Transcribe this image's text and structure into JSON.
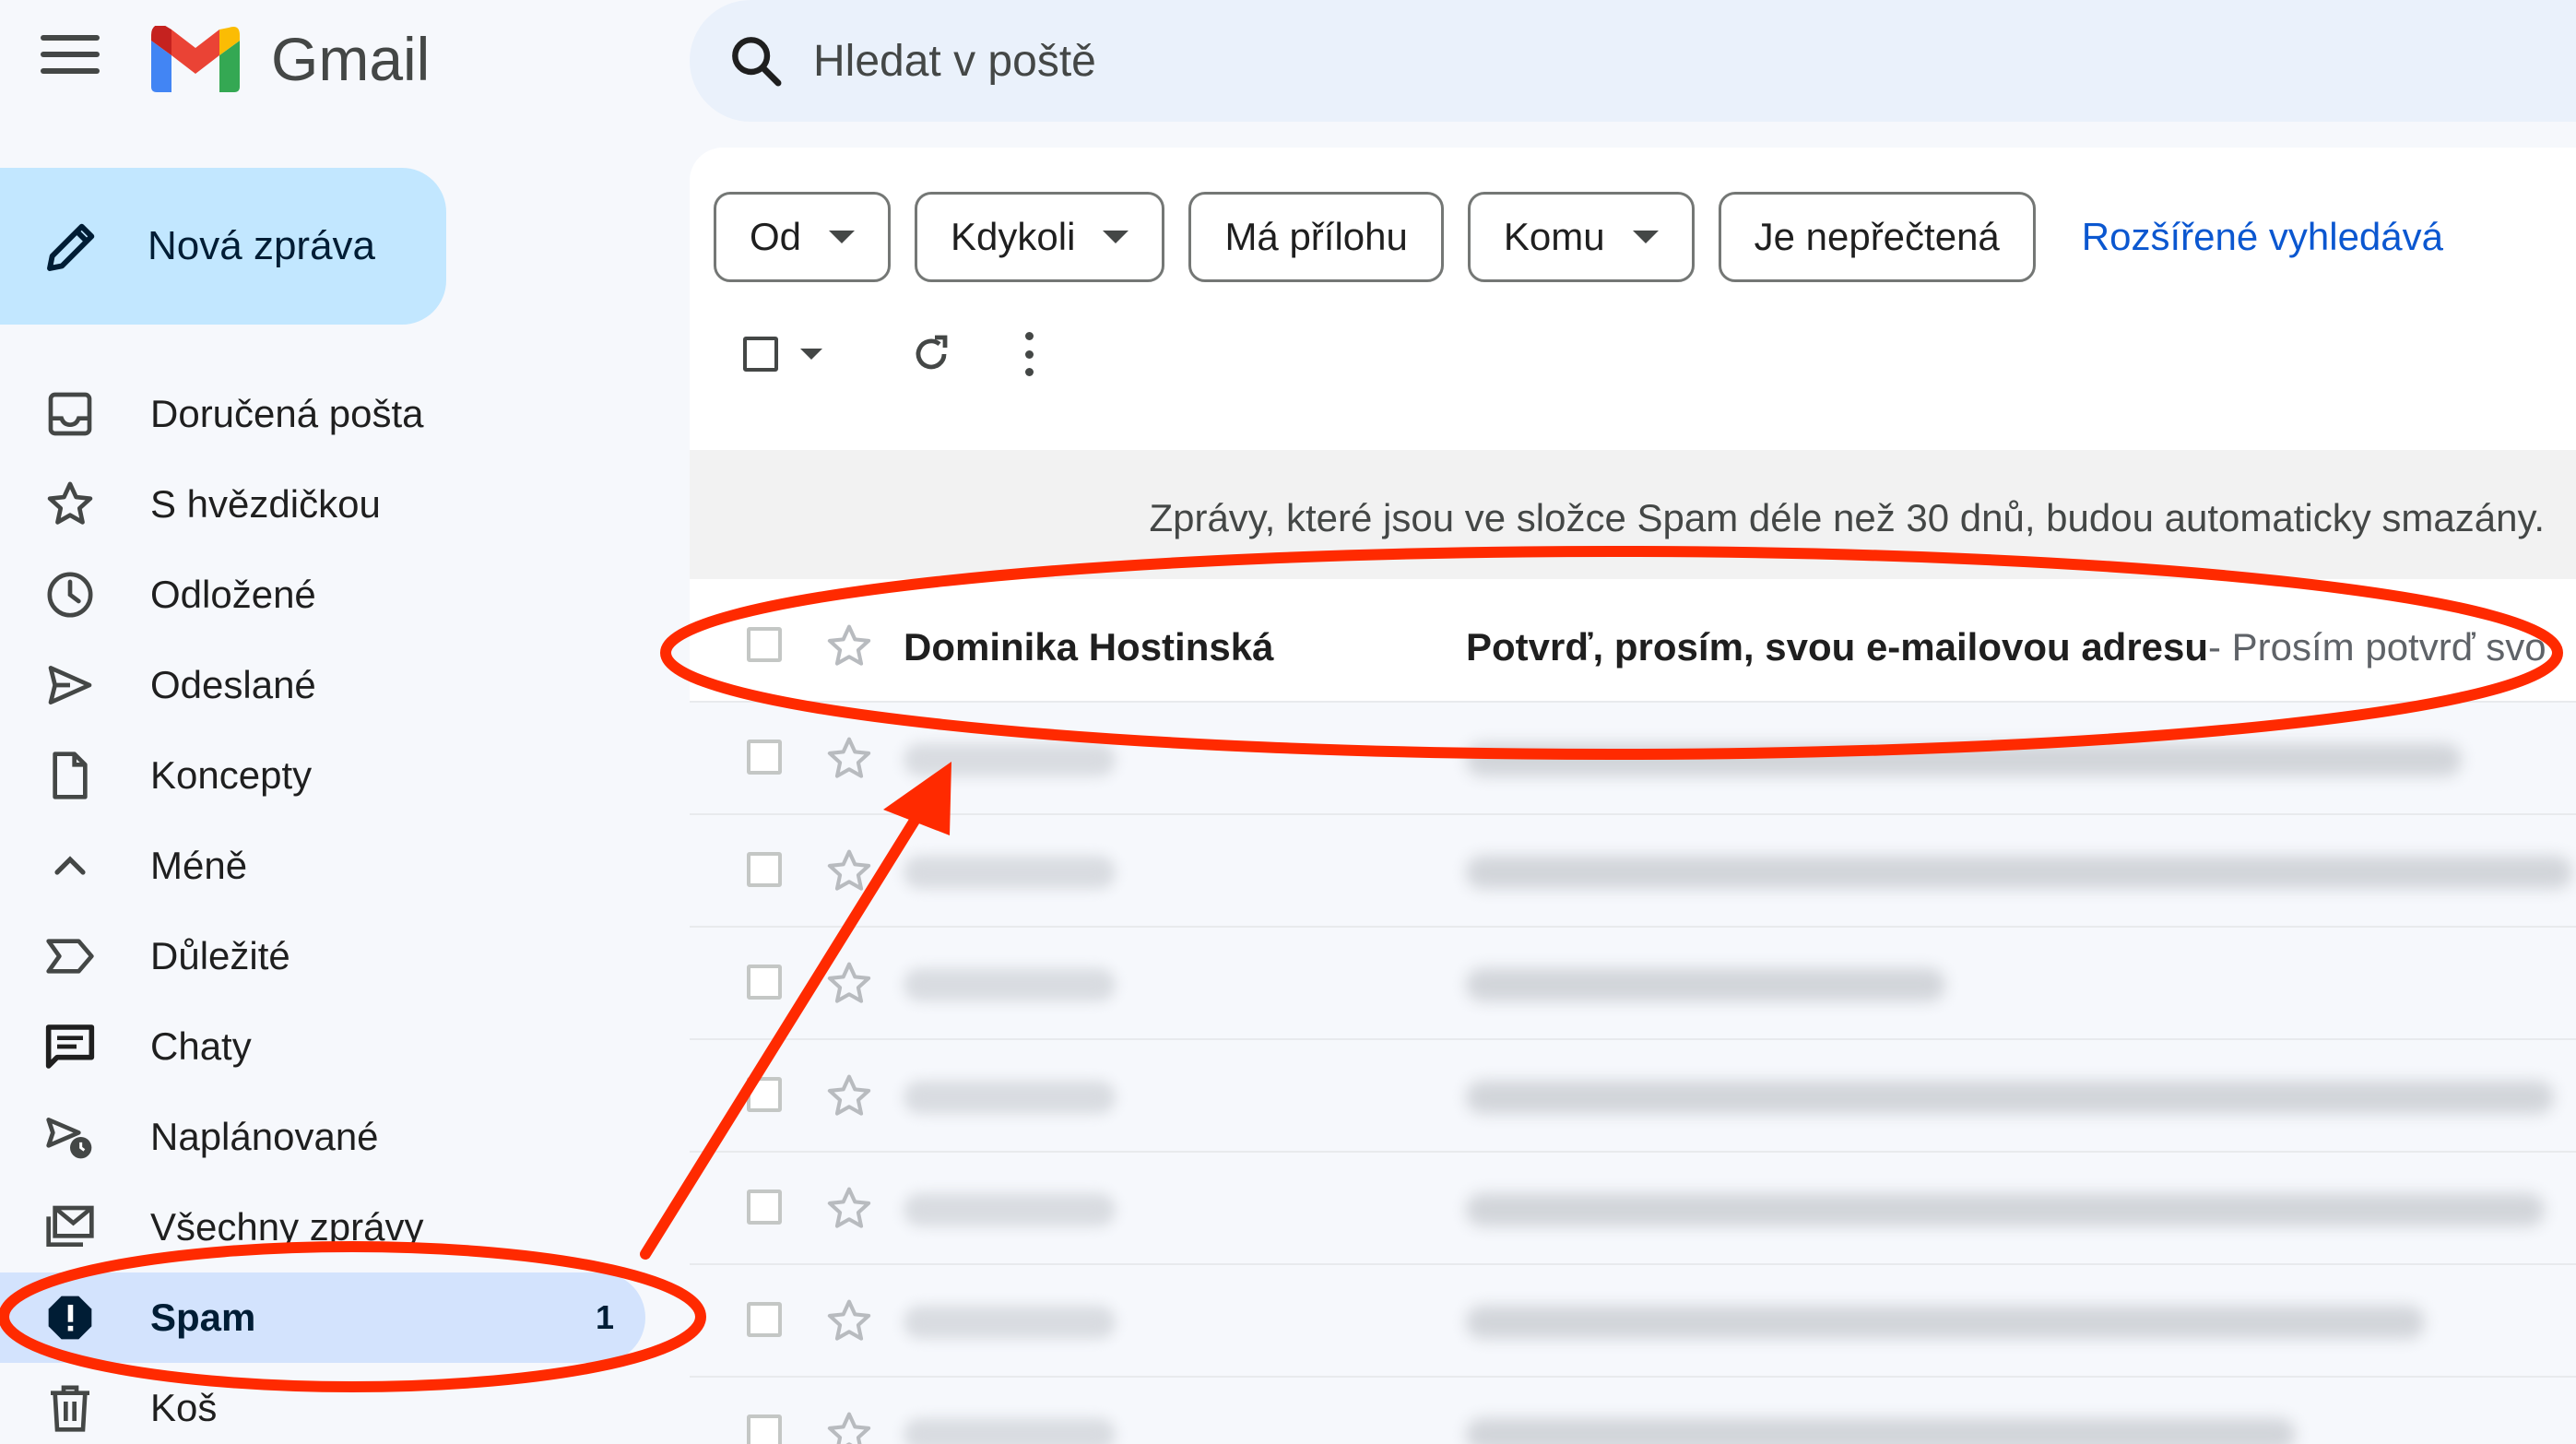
{
  "app": {
    "name": "Gmail",
    "colors": {
      "accent": "#0b57d0",
      "compose_bg": "#c2e7ff",
      "active_nav_bg": "#d3e3fd",
      "annotation_red": "#ff2a00"
    }
  },
  "search": {
    "placeholder": "Hledat v poště"
  },
  "compose": {
    "label": "Nová zpráva"
  },
  "sidebar": {
    "items": [
      {
        "label": "Doručená pošta",
        "icon": "inbox-icon"
      },
      {
        "label": "S hvězdičkou",
        "icon": "star-icon"
      },
      {
        "label": "Odložené",
        "icon": "clock-icon"
      },
      {
        "label": "Odeslané",
        "icon": "send-icon"
      },
      {
        "label": "Koncepty",
        "icon": "draft-icon"
      },
      {
        "label": "Méně",
        "icon": "chevron-up-icon"
      },
      {
        "label": "Důležité",
        "icon": "important-icon"
      },
      {
        "label": "Chaty",
        "icon": "chat-icon"
      },
      {
        "label": "Naplánované",
        "icon": "scheduled-icon"
      },
      {
        "label": "Všechny zprávy",
        "icon": "all-mail-icon"
      },
      {
        "label": "Spam",
        "icon": "spam-icon",
        "count": "1",
        "active": true
      },
      {
        "label": "Koš",
        "icon": "trash-icon"
      }
    ]
  },
  "filters": {
    "chips": [
      {
        "label": "Od",
        "dropdown": true
      },
      {
        "label": "Kdykoli",
        "dropdown": true
      },
      {
        "label": "Má přílohu",
        "dropdown": false
      },
      {
        "label": "Komu",
        "dropdown": true
      },
      {
        "label": "Je nepřečtená",
        "dropdown": false
      }
    ],
    "advanced_link": "Rozšířené vyhledává"
  },
  "banner": {
    "text": "Zprávy, které jsou ve složce Spam déle než 30 dnů, budou automaticky smazány."
  },
  "messages": [
    {
      "sender": "Dominika Hostinská",
      "subject": "Potvrď, prosím, svou e-mailovou adresu",
      "snippet": " - Prosím potvrď svo"
    }
  ]
}
